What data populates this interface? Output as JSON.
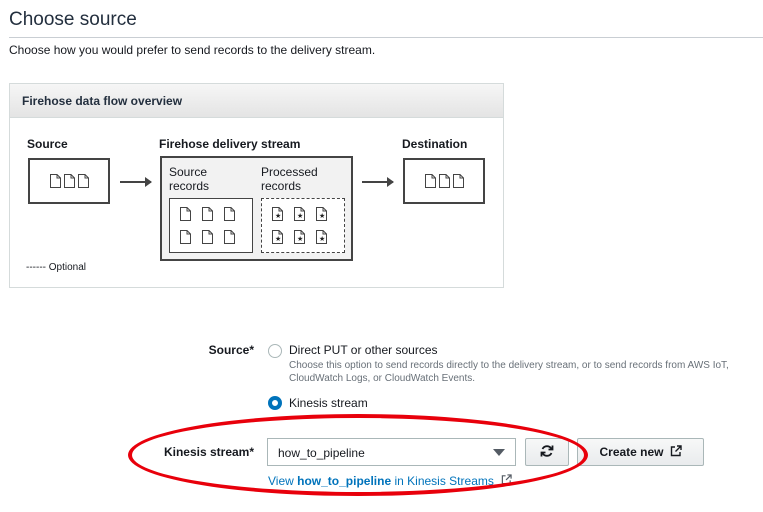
{
  "page": {
    "title": "Choose source",
    "description": "Choose how you would prefer to send records to the delivery stream."
  },
  "overview": {
    "header": "Firehose data flow overview",
    "source_label": "Source",
    "stream_label": "Firehose delivery stream",
    "destination_label": "Destination",
    "source_records_line1": "Source",
    "source_records_line2": "records",
    "processed_records_line1": "Processed",
    "processed_records_line2": "records",
    "optional_legend": "------ Optional"
  },
  "form": {
    "source_label": "Source*",
    "options": [
      {
        "label": "Direct PUT or other sources",
        "help": "Choose this option to send records directly to the delivery stream, or to send records from AWS IoT, CloudWatch Logs, or CloudWatch Events.",
        "selected": false
      },
      {
        "label": "Kinesis stream",
        "selected": true
      }
    ],
    "kinesis_stream_label": "Kinesis stream*",
    "kinesis_stream_value": "how_to_pipeline",
    "create_new_label": "Create new",
    "view_link_prefix": "View ",
    "view_link_name": "how_to_pipeline",
    "view_link_suffix": " in Kinesis Streams"
  },
  "icons": {
    "refresh": "refresh-icon",
    "external": "external-link-icon",
    "caret": "caret-down-icon",
    "document": "document-icon"
  },
  "colors": {
    "accent": "#0073bb",
    "annotation": "#e8000b"
  }
}
